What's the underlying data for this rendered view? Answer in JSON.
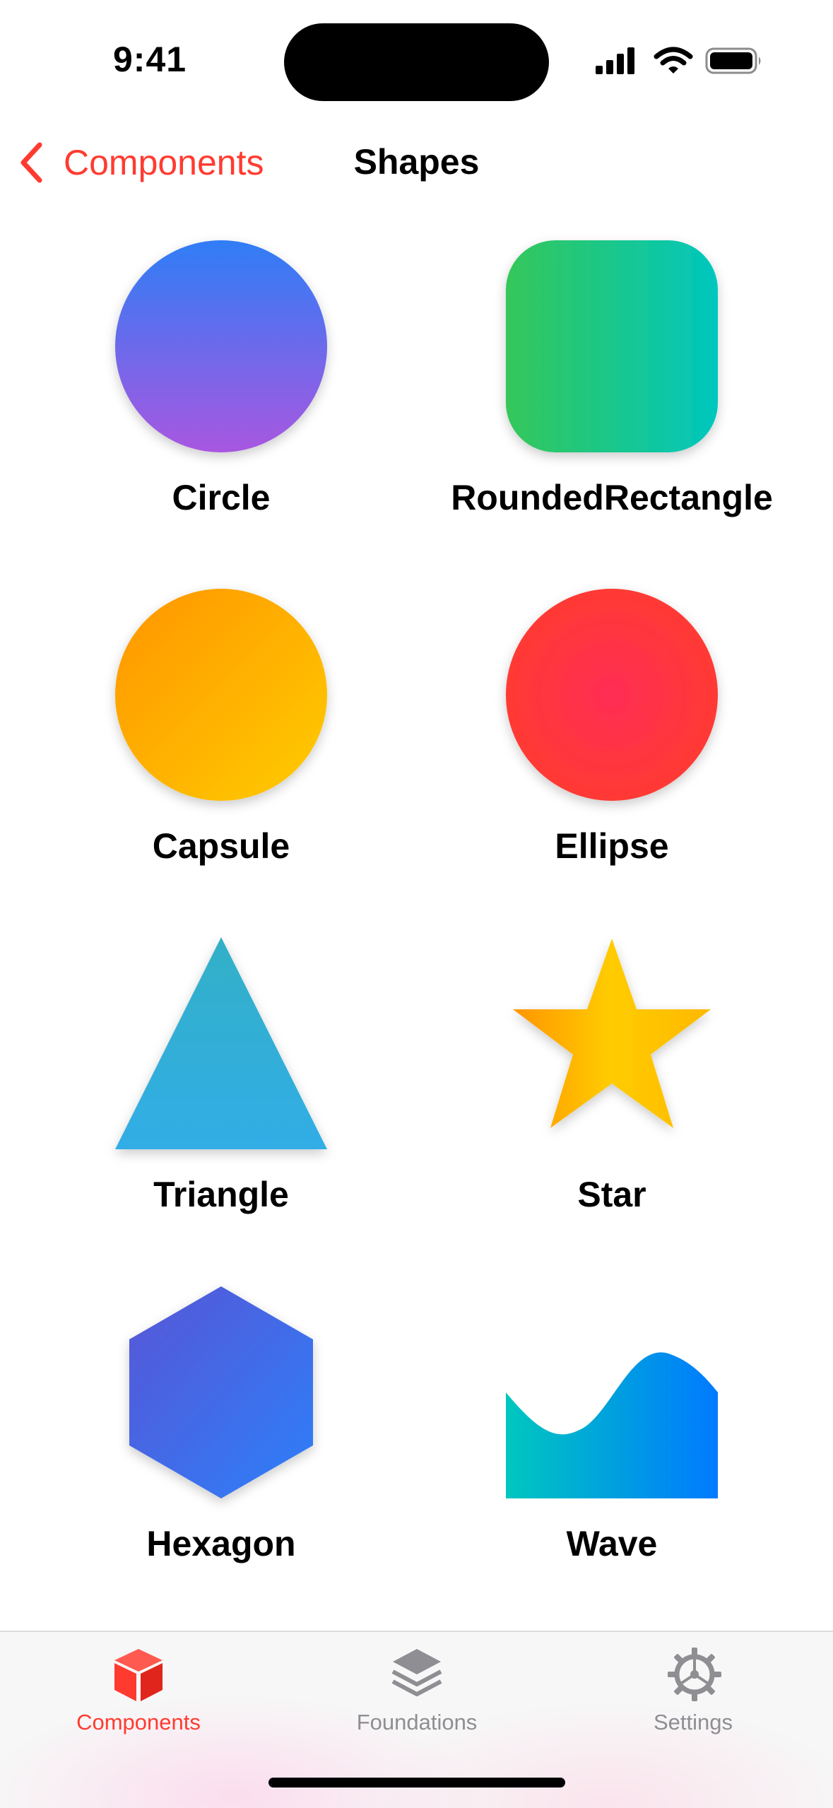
{
  "status_bar": {
    "time": "9:41"
  },
  "nav": {
    "back_label": "Components",
    "title": "Shapes"
  },
  "shapes": [
    {
      "label": "Circle",
      "icon": "circle-shape"
    },
    {
      "label": "RoundedRectangle",
      "icon": "rounded-rectangle-shape"
    },
    {
      "label": "Capsule",
      "icon": "capsule-shape"
    },
    {
      "label": "Ellipse",
      "icon": "ellipse-shape"
    },
    {
      "label": "Triangle",
      "icon": "triangle-shape"
    },
    {
      "label": "Star",
      "icon": "star-shape"
    },
    {
      "label": "Hexagon",
      "icon": "hexagon-shape"
    },
    {
      "label": "Wave",
      "icon": "wave-shape"
    }
  ],
  "tab_bar": {
    "tabs": [
      {
        "label": "Components",
        "icon": "cube-icon",
        "active": true
      },
      {
        "label": "Foundations",
        "icon": "layers-icon",
        "active": false
      },
      {
        "label": "Settings",
        "icon": "gear-icon",
        "active": false
      }
    ]
  },
  "colors": {
    "accent": "#ff3b30",
    "inactive_tab": "#8e8e93"
  }
}
